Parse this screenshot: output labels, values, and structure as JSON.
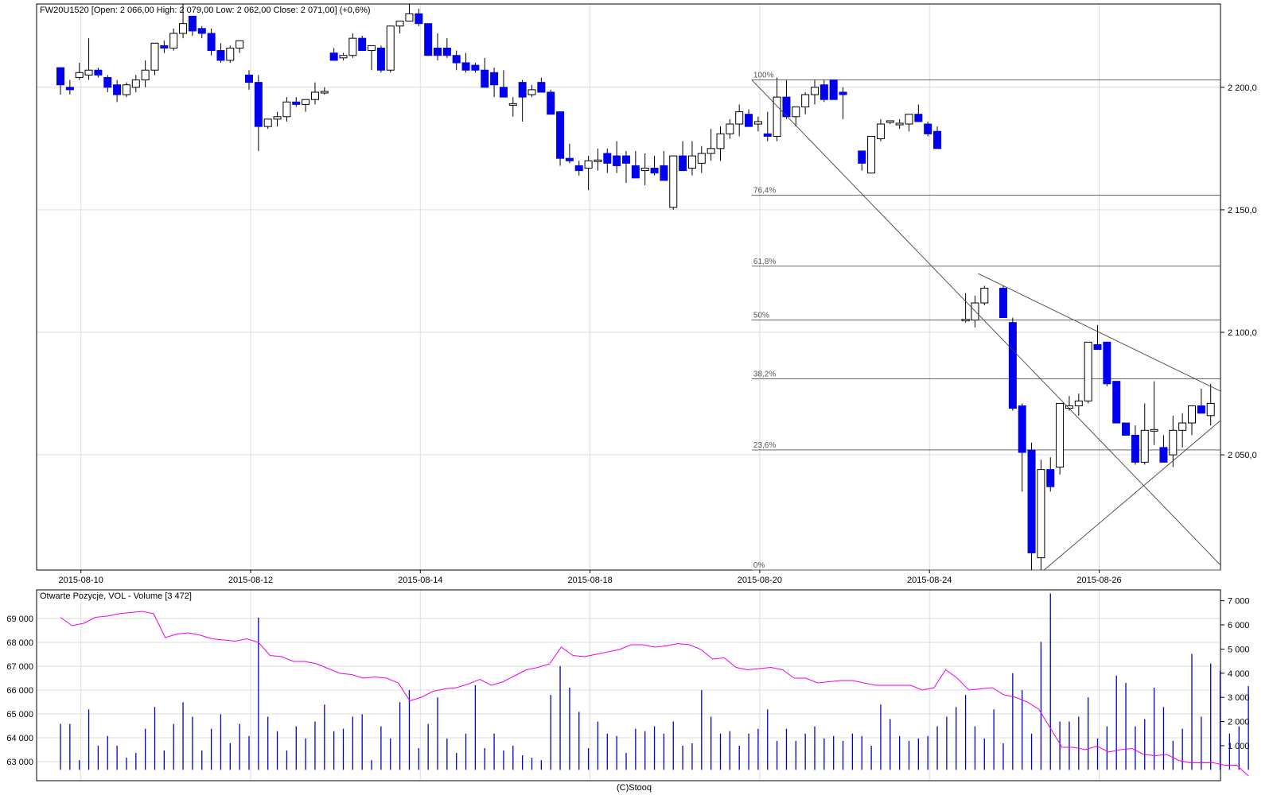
{
  "header": {
    "price_title": "FW20U1520 [Open: 2 066,00  High: 2 079,00  Low: 2 062,00  Close: 2 071,00] (+0,6%)",
    "volume_title": "Otwarte Pozycje, VOL - Volume [3 472]",
    "footer": "(C)Stooq"
  },
  "colors": {
    "down": "#0000ee",
    "up_fill": "#ffffff",
    "wick": "#000000",
    "oi_line": "#ee00ee",
    "volume": "#0000cc",
    "grid": "#dddddd"
  },
  "chart_data": [
    {
      "type": "candlestick",
      "ylim": [
        2003,
        2234
      ],
      "y_ticks": [
        2050,
        2100,
        2150,
        2200
      ],
      "y_tick_labels": [
        "2 050,0",
        "2 100,0",
        "2 150,0",
        "2 200,0"
      ],
      "x_tick_labels": [
        "2015-08-10",
        "2015-08-12",
        "2015-08-14",
        "2015-08-18",
        "2015-08-20",
        "2015-08-24",
        "2015-08-26"
      ],
      "x_tick_index": [
        2,
        20,
        38,
        56,
        74,
        92,
        110
      ],
      "slot_count": 122,
      "candles": [
        [
          0,
          2208,
          2208,
          2197,
          2201
        ],
        [
          1,
          2200,
          2203,
          2197,
          2199
        ],
        [
          2,
          2204,
          2210,
          2203,
          2206
        ],
        [
          3,
          2205,
          2220,
          2203,
          2207
        ],
        [
          4,
          2207,
          2208,
          2204,
          2205
        ],
        [
          5,
          2204,
          2205,
          2198,
          2200
        ],
        [
          6,
          2201,
          2203,
          2194,
          2197
        ],
        [
          7,
          2197,
          2202,
          2196,
          2201
        ],
        [
          8,
          2200,
          2205,
          2198,
          2203
        ],
        [
          9,
          2203,
          2211,
          2200,
          2207
        ],
        [
          10,
          2207,
          2218,
          2205,
          2218
        ],
        [
          11,
          2217,
          2219,
          2214,
          2216
        ],
        [
          12,
          2216,
          2224,
          2215,
          2222
        ],
        [
          13,
          2222,
          2234,
          2220,
          2226
        ],
        [
          14,
          2229,
          2229,
          2221,
          2223
        ],
        [
          15,
          2224,
          2225,
          2220,
          2222
        ],
        [
          16,
          2222,
          2224,
          2213,
          2215
        ],
        [
          17,
          2215,
          2218,
          2210,
          2211
        ],
        [
          18,
          2211,
          2217,
          2210,
          2216
        ],
        [
          19,
          2216,
          2219,
          2214,
          2219
        ],
        [
          20,
          2205,
          2207,
          2199,
          2202
        ],
        [
          21,
          2202,
          2205,
          2174,
          2184
        ],
        [
          22,
          2184,
          2187,
          2183,
          2187
        ],
        [
          23,
          2187,
          2190,
          2184,
          2188
        ],
        [
          24,
          2188,
          2196,
          2186,
          2194
        ],
        [
          25,
          2194,
          2196,
          2192,
          2193
        ],
        [
          26,
          2193,
          2194,
          2190,
          2195
        ],
        [
          27,
          2195,
          2202,
          2193,
          2198
        ],
        [
          28,
          2198,
          2200,
          2197,
          2198
        ],
        [
          29,
          2214,
          2216,
          2211,
          2211
        ],
        [
          30,
          2212,
          2214,
          2211,
          2213
        ],
        [
          31,
          2213,
          2222,
          2212,
          2220
        ],
        [
          32,
          2220,
          2221,
          2215,
          2215
        ],
        [
          33,
          2215,
          2217,
          2207,
          2217
        ],
        [
          34,
          2216,
          2217,
          2206,
          2207
        ],
        [
          35,
          2207,
          2225,
          2206,
          2225
        ],
        [
          36,
          2225,
          2226,
          2222,
          2227
        ],
        [
          37,
          2227,
          2234,
          2227,
          2230
        ],
        [
          38,
          2230,
          2232,
          2225,
          2226
        ],
        [
          39,
          2226,
          2226,
          2213,
          2213
        ],
        [
          40,
          2216,
          2222,
          2211,
          2213
        ],
        [
          41,
          2216,
          2220,
          2212,
          2213
        ],
        [
          42,
          2213,
          2215,
          2207,
          2210
        ],
        [
          43,
          2210,
          2214,
          2206,
          2207
        ],
        [
          44,
          2209,
          2210,
          2206,
          2207
        ],
        [
          45,
          2207,
          2212,
          2200,
          2200
        ],
        [
          46,
          2206,
          2208,
          2196,
          2201
        ],
        [
          47,
          2200,
          2207,
          2196,
          2196
        ],
        [
          48,
          2193,
          2196,
          2188,
          2193
        ],
        [
          49,
          2202,
          2203,
          2186,
          2196
        ],
        [
          50,
          2197,
          2201,
          2196,
          2199
        ],
        [
          51,
          2202,
          2204,
          2198,
          2198
        ],
        [
          52,
          2198,
          2199,
          2189,
          2189
        ],
        [
          53,
          2190,
          2190,
          2168,
          2171
        ],
        [
          54,
          2171,
          2177,
          2169,
          2170
        ],
        [
          55,
          2168,
          2170,
          2164,
          2166
        ],
        [
          56,
          2167,
          2172,
          2158,
          2170
        ],
        [
          57,
          2170,
          2175,
          2166,
          2170
        ],
        [
          58,
          2173,
          2175,
          2165,
          2169
        ],
        [
          59,
          2172,
          2178,
          2165,
          2168
        ],
        [
          60,
          2172,
          2174,
          2161,
          2169
        ],
        [
          61,
          2168,
          2174,
          2164,
          2163
        ],
        [
          62,
          2166,
          2173,
          2160,
          2167
        ],
        [
          63,
          2167,
          2172,
          2164,
          2165
        ],
        [
          64,
          2168,
          2174,
          2162,
          2162
        ],
        [
          65,
          2151,
          2172,
          2150,
          2172
        ],
        [
          66,
          2172,
          2178,
          2166,
          2166
        ],
        [
          67,
          2167,
          2178,
          2164,
          2172
        ],
        [
          68,
          2169,
          2176,
          2165,
          2173
        ],
        [
          69,
          2173,
          2183,
          2170,
          2175
        ],
        [
          70,
          2175,
          2184,
          2170,
          2181
        ],
        [
          71,
          2181,
          2187,
          2179,
          2185
        ],
        [
          72,
          2185,
          2193,
          2180,
          2190
        ],
        [
          73,
          2189,
          2191,
          2184,
          2184
        ],
        [
          74,
          2185,
          2188,
          2182,
          2186
        ],
        [
          75,
          2181,
          2190,
          2178,
          2180
        ],
        [
          76,
          2180,
          2204,
          2178,
          2196
        ],
        [
          77,
          2196,
          2203,
          2187,
          2188
        ],
        [
          78,
          2188,
          2192,
          2184,
          2192
        ],
        [
          79,
          2192,
          2198,
          2189,
          2197
        ],
        [
          80,
          2197,
          2203,
          2193,
          2200
        ],
        [
          81,
          2201,
          2203,
          2194,
          2195
        ],
        [
          82,
          2203,
          2203,
          2195,
          2195
        ],
        [
          83,
          2198,
          2200,
          2187,
          2197
        ],
        [
          85,
          2174,
          2174,
          2166,
          2169
        ],
        [
          86,
          2165,
          2180,
          2165,
          2180
        ],
        [
          87,
          2179,
          2187,
          2178,
          2185
        ],
        [
          88,
          2186,
          2186,
          2185,
          2186
        ],
        [
          89,
          2185,
          2187,
          2183,
          2185
        ],
        [
          90,
          2185,
          2187,
          2182,
          2189
        ],
        [
          91,
          2189,
          2193,
          2186,
          2186
        ],
        [
          92,
          2185,
          2186,
          2180,
          2181
        ],
        [
          93,
          2182,
          2184,
          2175,
          2175
        ],
        [
          96,
          2105,
          2116,
          2104,
          2105
        ],
        [
          97,
          2105,
          2115,
          2102,
          2112
        ],
        [
          98,
          2112,
          2119,
          2111,
          2118
        ],
        [
          100,
          2118,
          2119,
          2106,
          2106
        ],
        [
          101,
          2104,
          2106,
          2068,
          2069
        ],
        [
          102,
          2070,
          2071,
          2035,
          2051
        ],
        [
          103,
          2052,
          2055,
          2003,
          2010
        ],
        [
          104,
          2008,
          2048,
          2003,
          2044
        ],
        [
          105,
          2044,
          2049,
          2035,
          2037
        ],
        [
          106,
          2045,
          2071,
          2042,
          2071
        ],
        [
          107,
          2069,
          2074,
          2068,
          2070
        ],
        [
          108,
          2070,
          2075,
          2066,
          2072
        ],
        [
          109,
          2072,
          2096,
          2071,
          2096
        ],
        [
          110,
          2095,
          2103,
          2093,
          2093
        ],
        [
          111,
          2096,
          2096,
          2078,
          2079
        ],
        [
          112,
          2080,
          2080,
          2063,
          2063
        ],
        [
          113,
          2063,
          2063,
          2058,
          2058
        ],
        [
          114,
          2058,
          2062,
          2046,
          2047
        ],
        [
          115,
          2047,
          2071,
          2046,
          2060
        ],
        [
          116,
          2060,
          2080,
          2054,
          2060
        ],
        [
          117,
          2053,
          2058,
          2047,
          2047
        ],
        [
          118,
          2050,
          2066,
          2045,
          2060
        ],
        [
          119,
          2060,
          2067,
          2053,
          2063
        ],
        [
          120,
          2063,
          2070,
          2058,
          2070
        ],
        [
          121,
          2070,
          2077,
          2067,
          2067
        ],
        [
          122,
          2066,
          2079,
          2062,
          2071
        ]
      ],
      "fibonacci": {
        "levels": [
          "100%",
          "76,4%",
          "61,8%",
          "50%",
          "38,2%",
          "23,6%",
          "0%"
        ],
        "prices": [
          2203,
          2156,
          2127,
          2105,
          2081,
          2052,
          2003
        ]
      },
      "trendlines": [
        {
          "from": [
            74,
            2203
          ],
          "to": [
            122,
            2005
          ]
        },
        {
          "from": [
            98,
            2124
          ],
          "to": [
            122,
            2076
          ]
        },
        {
          "from": [
            105,
            2003
          ],
          "to": [
            122,
            2064
          ]
        }
      ]
    },
    {
      "type": "bar_line",
      "left_ylim": [
        62200,
        70200
      ],
      "left_ticks": [
        63000,
        64000,
        65000,
        66000,
        67000,
        68000,
        69000
      ],
      "left_tick_labels": [
        "63 000",
        "64 000",
        "65 000",
        "66 000",
        "67 000",
        "68 000",
        "69 000"
      ],
      "right_ylim": [
        -450,
        7450
      ],
      "right_ticks": [
        1000,
        2000,
        3000,
        4000,
        5000,
        6000,
        7000
      ],
      "right_tick_labels": [
        "1 000",
        "2 000",
        "3 000",
        "4 000",
        "5 000",
        "6 000",
        "7 000"
      ],
      "volume": [
        1900,
        1900,
        400,
        2500,
        1000,
        1400,
        1000,
        500,
        700,
        1700,
        2600,
        800,
        1900,
        2800,
        2200,
        800,
        1700,
        2300,
        1100,
        1900,
        1400,
        6300,
        2200,
        1600,
        800,
        1800,
        1300,
        2000,
        2700,
        1600,
        1700,
        2200,
        2300,
        400,
        1800,
        1300,
        2800,
        3300,
        900,
        1900,
        3000,
        1300,
        700,
        1500,
        3500,
        900,
        1500,
        800,
        1000,
        600,
        500,
        400,
        3100,
        4300,
        3400,
        2400,
        900,
        2000,
        1500,
        1400,
        700,
        1700,
        1600,
        1800,
        1500,
        2000,
        1000,
        1100,
        3300,
        2200,
        1500,
        1600,
        1000,
        1500,
        1700,
        2500,
        1200,
        1700,
        1200,
        1500,
        1800,
        1300,
        1400,
        1200,
        1500,
        1400,
        1000,
        2700,
        2100,
        1400,
        1200,
        1300,
        1400,
        1800,
        2200,
        2600,
        3100,
        1800,
        1300,
        2500,
        1100,
        4000,
        3300,
        1500,
        5300,
        7300,
        2000,
        2000,
        2200,
        3000,
        1300,
        1800,
        3900,
        3600,
        1800,
        2100,
        3400,
        2600,
        1200,
        1700,
        4800,
        2200,
        4400,
        4100,
        1500,
        1800,
        3472
      ],
      "open_interest": [
        69050,
        68700,
        68800,
        69050,
        69100,
        69200,
        69250,
        69300,
        69200,
        68200,
        68350,
        68400,
        68300,
        68150,
        68100,
        68050,
        68150,
        68000,
        67450,
        67400,
        67200,
        67200,
        67100,
        66900,
        66700,
        66650,
        66500,
        66550,
        66500,
        66300,
        65550,
        65700,
        65950,
        66050,
        66100,
        66250,
        66450,
        66200,
        66350,
        66600,
        66850,
        66950,
        67100,
        67800,
        67450,
        67400,
        67500,
        67600,
        67700,
        67900,
        67900,
        67800,
        67850,
        67950,
        67900,
        67700,
        67300,
        67350,
        66950,
        66850,
        66900,
        66950,
        66850,
        66500,
        66500,
        66300,
        66350,
        66400,
        66400,
        66300,
        66200,
        66200,
        66200,
        66200,
        66000,
        66100,
        66850,
        66500,
        66000,
        66050,
        66100,
        65800,
        65700,
        65500,
        65200,
        64400,
        63600,
        63600,
        63500,
        63650,
        63400,
        63500,
        63550,
        63300,
        63250,
        63300,
        63050,
        62950,
        62950,
        62950,
        62850,
        62850,
        62400
      ]
    }
  ]
}
